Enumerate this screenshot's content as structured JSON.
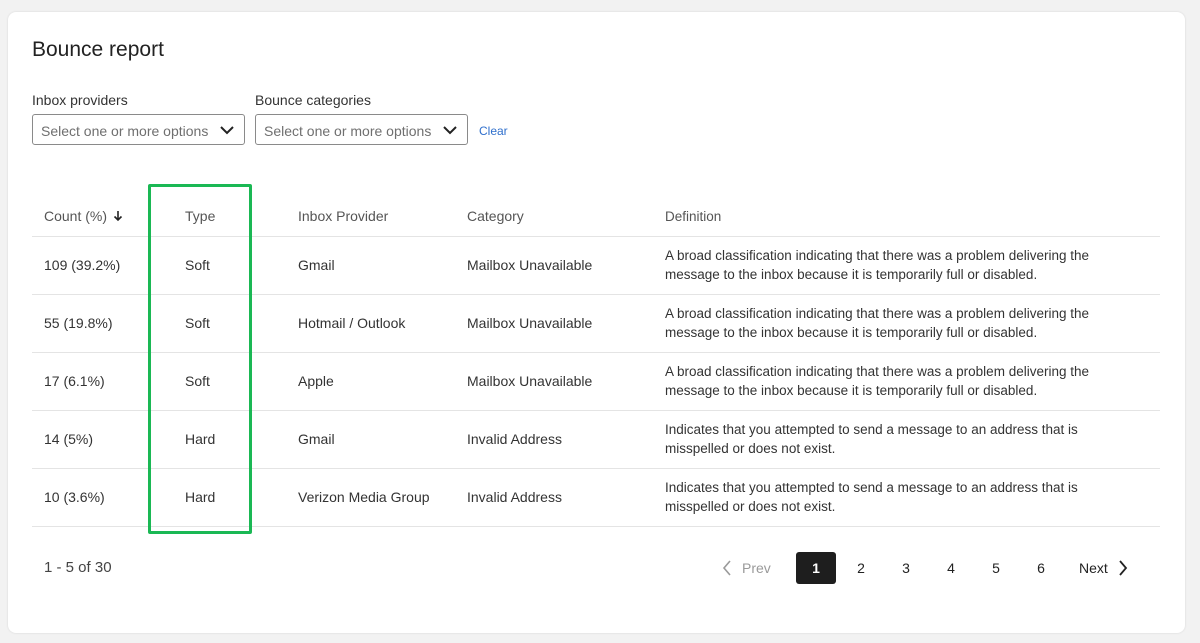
{
  "title": "Bounce report",
  "filters": {
    "inbox_providers": {
      "label": "Inbox providers",
      "placeholder": "Select one or more options"
    },
    "bounce_categories": {
      "label": "Bounce categories",
      "placeholder": "Select one or more options"
    },
    "clear_label": "Clear"
  },
  "table": {
    "headers": {
      "count": "Count (%)",
      "type": "Type",
      "provider": "Inbox Provider",
      "category": "Category",
      "definition": "Definition"
    },
    "sort": {
      "column": "count",
      "direction": "descending"
    },
    "rows": [
      {
        "count": "109 (39.2%)",
        "type": "Soft",
        "provider": "Gmail",
        "category": "Mailbox Unavailable",
        "definition_line1": "A broad classification indicating that there was a problem delivering the",
        "definition_line2": "message to the inbox because it is temporarily full or disabled."
      },
      {
        "count": "55 (19.8%)",
        "type": "Soft",
        "provider": "Hotmail / Outlook",
        "category": "Mailbox Unavailable",
        "definition_line1": "A broad classification indicating that there was a problem delivering the",
        "definition_line2": "message to the inbox because it is temporarily full or disabled."
      },
      {
        "count": "17 (6.1%)",
        "type": "Soft",
        "provider": "Apple",
        "category": "Mailbox Unavailable",
        "definition_line1": "A broad classification indicating that there was a problem delivering the",
        "definition_line2": "message to the inbox because it is temporarily full or disabled."
      },
      {
        "count": "14 (5%)",
        "type": "Hard",
        "provider": "Gmail",
        "category": "Invalid Address",
        "definition_line1": "Indicates that you attempted to send a message to an address that is",
        "definition_line2": "misspelled or does not exist."
      },
      {
        "count": "10 (3.6%)",
        "type": "Hard",
        "provider": "Verizon Media Group",
        "category": "Invalid Address",
        "definition_line1": "Indicates that you attempted to send a message to an address that is",
        "definition_line2": "misspelled or does not exist."
      }
    ]
  },
  "pagination": {
    "range_text": "1 - 5 of 30",
    "prev_label": "Prev",
    "next_label": "Next",
    "pages": [
      "1",
      "2",
      "3",
      "4",
      "5",
      "6"
    ],
    "current_page": "1"
  },
  "colors": {
    "highlight": "#1ab854",
    "link": "#2f6fcc",
    "active_page_bg": "#1e1e1e"
  }
}
